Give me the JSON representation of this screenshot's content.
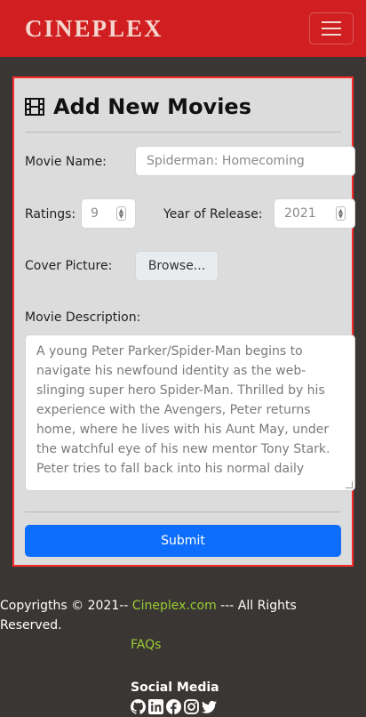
{
  "navbar": {
    "brand": "CINEPLEX",
    "menu_icon": "hamburger-menu-icon"
  },
  "form": {
    "title": "Add New Movies",
    "title_icon": "film-icon",
    "movie_name": {
      "label": "Movie Name:",
      "value": "Spiderman: Homecoming"
    },
    "ratings": {
      "label": "Ratings:",
      "value": "9"
    },
    "year": {
      "label": "Year of Release:",
      "value": "2021"
    },
    "cover": {
      "label": "Cover Picture:",
      "button": "Browse..."
    },
    "description": {
      "label": "Movie Description:",
      "value": "A young Peter Parker/Spider-Man begins to navigate his newfound identity as the web-slinging super hero Spider-Man. Thrilled by his experience with the Avengers, Peter returns home, where he lives with his Aunt May, under the watchful eye of his new mentor Tony Stark. Peter tries to fall back into his normal daily"
    },
    "submit": "Submit"
  },
  "footer": {
    "copy_prefix": "Copyrigths © 2021-- ",
    "copy_link": "Cineplex.com",
    "copy_suffix": " --- All Rights Reserved.",
    "faqs": "FAQs",
    "social_title": "Social Media",
    "social_icons": [
      "github-icon",
      "linkedin-icon",
      "facebook-icon",
      "instagram-icon",
      "twitter-icon"
    ]
  },
  "colors": {
    "navbar": "#d11f21",
    "card_border": "#ff2b2b",
    "submit": "#0d6efd",
    "link": "#9acd32"
  }
}
